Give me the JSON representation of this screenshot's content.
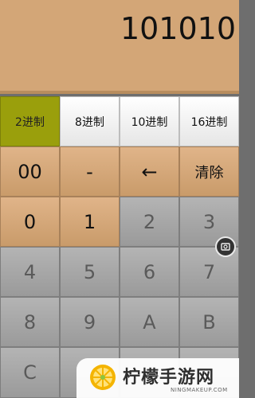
{
  "display": {
    "value": "101010"
  },
  "keys": {
    "base2": "2进制",
    "base8": "8进制",
    "base10": "10进制",
    "base16": "16进制",
    "double_zero": "00",
    "minus": "-",
    "backspace": "←",
    "clear": "清除",
    "k0": "0",
    "k1": "1",
    "k2": "2",
    "k3": "3",
    "k4": "4",
    "k5": "5",
    "k6": "6",
    "k7": "7",
    "k8": "8",
    "k9": "9",
    "kA": "A",
    "kB": "B",
    "kC": "C"
  },
  "overlay": {
    "side_icon": "screenshot-icon"
  },
  "watermark": {
    "title": "柠檬手游网",
    "url": "NINGMAKEUP.COM"
  },
  "colors": {
    "display_bg": "#d3a677",
    "active_key": "#9a9f0c",
    "brown_key": "#d8ab7c",
    "gray_key": "#a6a6a6",
    "white_key": "#f2f2f2"
  }
}
